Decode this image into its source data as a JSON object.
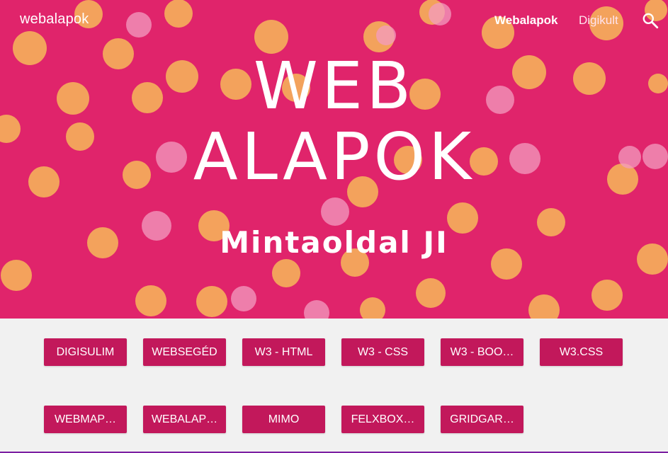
{
  "header": {
    "site_title": "webalapok",
    "nav": [
      {
        "label": "Webalapok",
        "active": true
      },
      {
        "label": "Digikult",
        "active": false
      }
    ],
    "search_icon": "search-icon"
  },
  "hero": {
    "title_line1": "WEB",
    "title_line2": "ALAPOK",
    "subtitle": "Mintaoldal JI",
    "background_color": "#e0246b"
  },
  "buttons": [
    "DIGISULIM",
    "WEBSEGÉD",
    "W3 - HTML",
    "W3 - CSS",
    "W3 - BOO…",
    "W3.CSS",
    "WEBMAP…",
    "WEBALAP…",
    "MIMO",
    "FELXBOX…",
    "GRIDGAR…"
  ],
  "colors": {
    "accent": "#c2185b",
    "background": "#f1f1f1"
  }
}
